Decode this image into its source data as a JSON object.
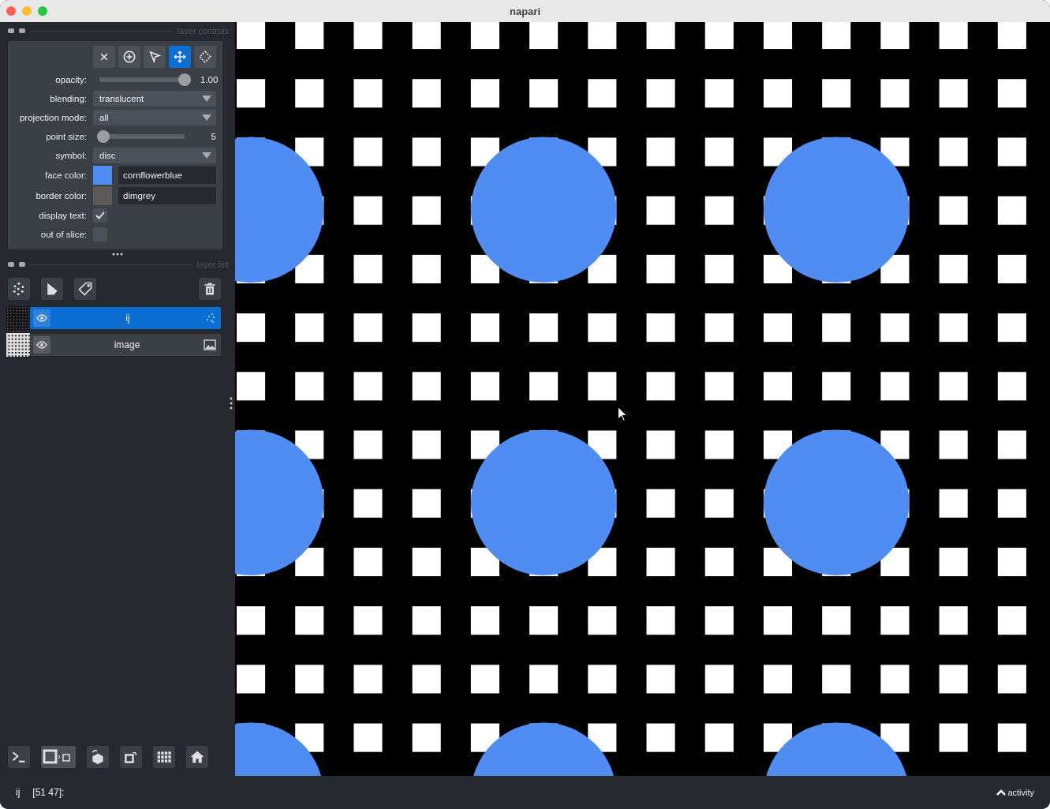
{
  "window": {
    "title": "napari"
  },
  "layer_controls": {
    "title": "layer controls",
    "mode_buttons": [
      {
        "kind": "delete",
        "selected": false
      },
      {
        "kind": "add",
        "selected": false
      },
      {
        "kind": "select",
        "selected": false
      },
      {
        "kind": "pan",
        "selected": true
      },
      {
        "kind": "transform",
        "selected": false
      }
    ],
    "rows": [
      {
        "kind": "slider",
        "label": "opacity:",
        "level": 1.0,
        "reading": "1.00"
      },
      {
        "kind": "dropdown",
        "label": "blending:",
        "value": "translucent"
      },
      {
        "kind": "dropdown",
        "label": "projection mode:",
        "value": "all"
      },
      {
        "kind": "slider",
        "label": "point size:",
        "level": 0.05,
        "reading": "5"
      },
      {
        "kind": "dropdown",
        "label": "symbol:",
        "value": "disc"
      },
      {
        "kind": "color",
        "label": "face color:",
        "color": "#4f8df2",
        "value": "cornflowerblue"
      },
      {
        "kind": "color",
        "label": "border color:",
        "color": "#5a5a5a",
        "value": "dimgrey"
      },
      {
        "kind": "checkbox",
        "label": "display text:",
        "checked": true
      },
      {
        "kind": "checkbox",
        "label": "out of slice:",
        "checked": false
      }
    ]
  },
  "layer_list": {
    "title": "layer list",
    "layers": [
      {
        "kind": "points",
        "name": "ij",
        "selected": true
      },
      {
        "kind": "image",
        "name": "image",
        "selected": false
      }
    ]
  },
  "status_bar": {
    "layer": "ij",
    "coordinates": "[51 47]:",
    "activity": "activity"
  }
}
